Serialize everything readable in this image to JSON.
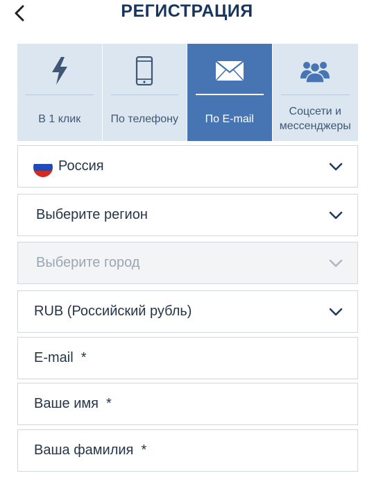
{
  "header": {
    "title": "РЕГИСТРАЦИЯ"
  },
  "tabs": [
    {
      "label": "В 1 клик",
      "icon": "lightning-icon",
      "active": false
    },
    {
      "label": "По телефону",
      "icon": "phone-icon",
      "active": false
    },
    {
      "label": "По E-mail",
      "icon": "envelope-icon",
      "active": true
    },
    {
      "label": "Соцсети и мессенджеры",
      "icon": "users-icon",
      "active": false
    }
  ],
  "form": {
    "country": "Россия",
    "region": "Выберите регион",
    "city": "Выберите город",
    "currency": "RUB (Российский рубль)",
    "email": "E-mail  *",
    "first_name": "Ваше имя  *",
    "last_name": "Ваша фамилия  *"
  },
  "colors": {
    "accent": "#4775b4",
    "tab_bg": "#dbe6f1",
    "title": "#16355f"
  }
}
